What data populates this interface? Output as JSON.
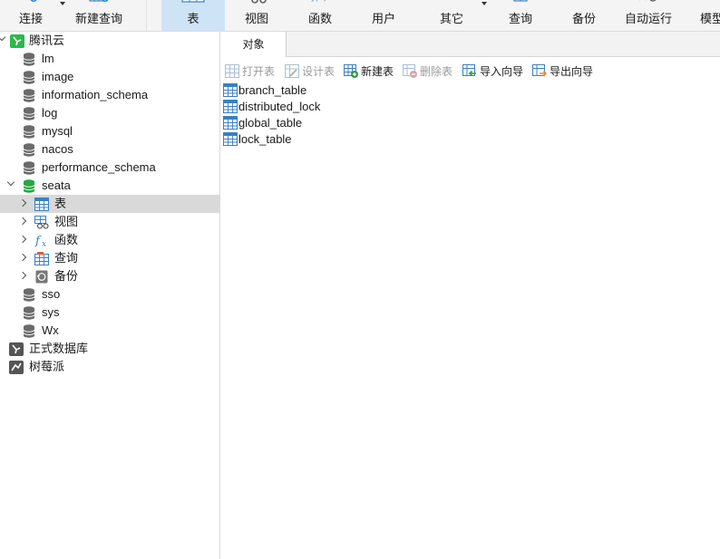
{
  "toolbar": {
    "connect_label": "连接",
    "new_query_label": "新建查询",
    "table_label": "表",
    "view_label": "视图",
    "function_label": "函数",
    "user_label": "用户",
    "other_label": "其它",
    "query_label": "查询",
    "backup_label": "备份",
    "autorun_label": "自动运行",
    "model_label": "模型"
  },
  "sidebar": {
    "connection": "腾讯云",
    "databases": [
      "lm",
      "image",
      "information_schema",
      "log",
      "mysql",
      "nacos",
      "performance_schema"
    ],
    "open_database": "seata",
    "seata_children": [
      "表",
      "视图",
      "函数",
      "查询",
      "备份"
    ],
    "databases_after": [
      "sso",
      "sys",
      "Wx"
    ],
    "other_connections": [
      "正式数据库",
      "树莓派"
    ]
  },
  "tabs": {
    "objects": "对象"
  },
  "object_toolbar": {
    "open_table": "打开表",
    "design_table": "设计表",
    "new_table": "新建表",
    "delete_table": "删除表",
    "import_wizard": "导入向导",
    "export_wizard": "导出向导"
  },
  "tables": [
    "branch_table",
    "distributed_lock",
    "global_table",
    "lock_table"
  ],
  "colors": {
    "accent": "#cfe3f7",
    "db_gray": "#6b6b6b",
    "db_open_green": "#27a844",
    "connection_green": "#2db84b",
    "selection": "#d9d9d9"
  }
}
